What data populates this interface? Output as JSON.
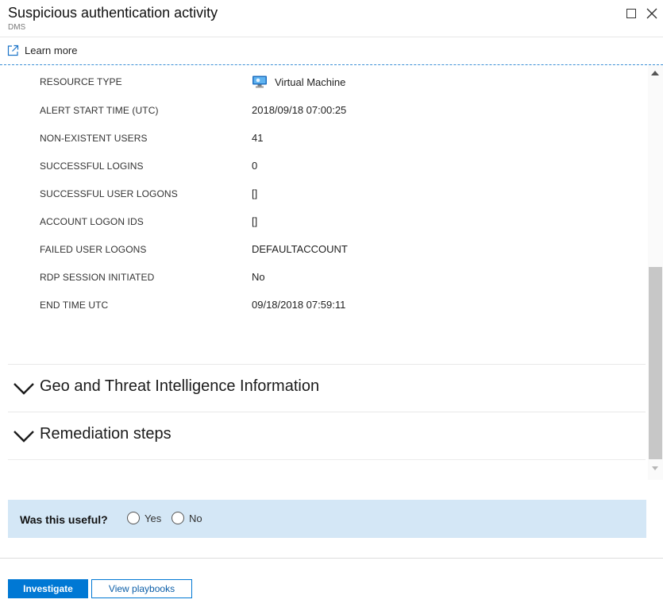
{
  "header": {
    "title": "Suspicious authentication activity",
    "subtitle": "DMS"
  },
  "learn_more": {
    "label": "Learn more",
    "icon": "external-link-icon"
  },
  "properties": [
    {
      "label": "RESOURCE TYPE",
      "value": "Virtual Machine",
      "icon": "virtual-machine-icon"
    },
    {
      "label": "ALERT START TIME (UTC)",
      "value": "2018/09/18 07:00:25"
    },
    {
      "label": "NON-EXISTENT USERS",
      "value": "41"
    },
    {
      "label": "SUCCESSFUL LOGINS",
      "value": "0"
    },
    {
      "label": "SUCCESSFUL USER LOGONS",
      "value": "[]"
    },
    {
      "label": "ACCOUNT LOGON IDS",
      "value": "[]"
    },
    {
      "label": "FAILED USER LOGONS",
      "value": "DEFAULTACCOUNT"
    },
    {
      "label": "RDP SESSION INITIATED",
      "value": "No"
    },
    {
      "label": "END TIME UTC",
      "value": "09/18/2018 07:59:11"
    }
  ],
  "sections": [
    {
      "title": "Geo and Threat Intelligence Information"
    },
    {
      "title": "Remediation steps"
    }
  ],
  "feedback": {
    "question": "Was this useful?",
    "options": [
      "Yes",
      "No"
    ]
  },
  "actions": {
    "investigate_label": "Investigate",
    "playbooks_label": "View playbooks"
  },
  "colors": {
    "accent": "#0078d4",
    "feedback_bg": "#d4e7f6"
  }
}
